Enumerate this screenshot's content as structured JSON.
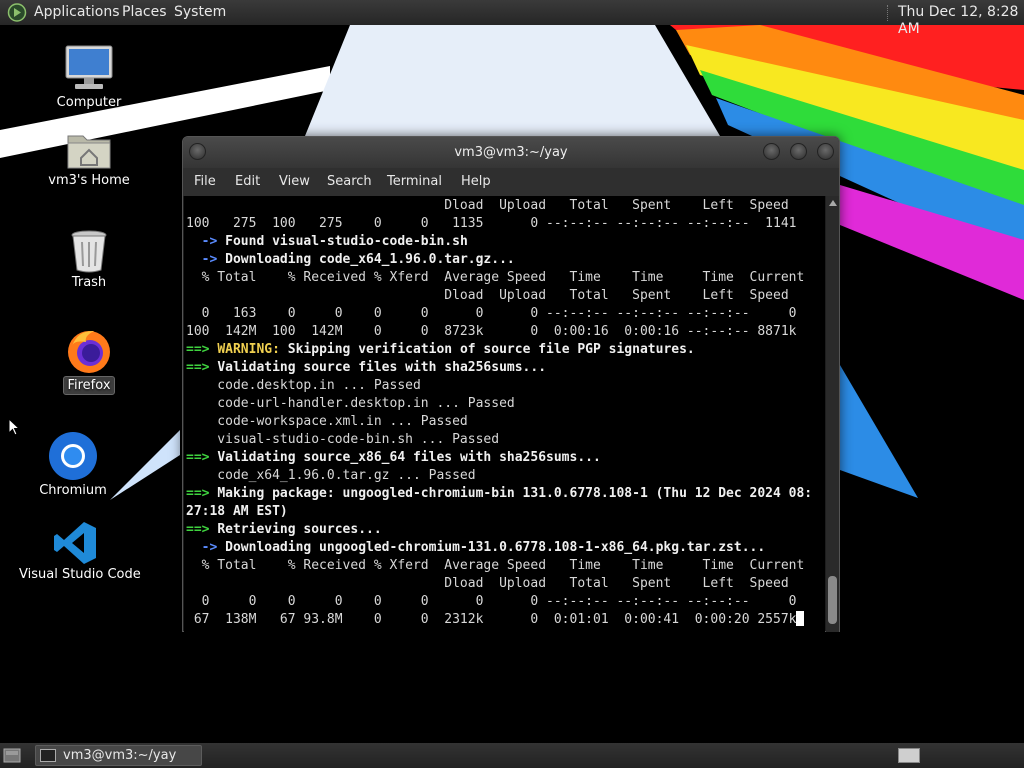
{
  "top_panel": {
    "menus": [
      "Applications",
      "Places",
      "System"
    ],
    "clock": "Thu Dec 12,  8:28 AM"
  },
  "desktop_icons": [
    {
      "label": "Computer",
      "icon": "computer-icon"
    },
    {
      "label": "vm3's Home",
      "icon": "home-folder-icon"
    },
    {
      "label": "Trash",
      "icon": "trash-icon"
    },
    {
      "label": "Firefox",
      "icon": "firefox-icon"
    },
    {
      "label": "Chromium",
      "icon": "chromium-icon"
    },
    {
      "label": "Visual Studio Code",
      "icon": "vscode-icon"
    }
  ],
  "terminal": {
    "title": "vm3@vm3:~/yay",
    "menu": [
      "File",
      "Edit",
      "View",
      "Search",
      "Terminal",
      "Help"
    ],
    "lines": [
      "                                 Dload  Upload   Total   Spent    Left  Speed",
      "100   275  100   275    0     0   1135      0 --:--:-- --:--:-- --:--:--  1141",
      "  -> Found visual-studio-code-bin.sh",
      "  -> Downloading code_x64_1.96.0.tar.gz...",
      "  % Total    % Received % Xferd  Average Speed   Time    Time     Time  Current",
      "                                 Dload  Upload   Total   Spent    Left  Speed",
      "  0   163    0     0    0     0      0      0 --:--:-- --:--:-- --:--:--     0",
      "100  142M  100  142M    0     0  8723k      0  0:00:16  0:00:16 --:--:-- 8871k",
      "==> WARNING: Skipping verification of source file PGP signatures.",
      "==> Validating source files with sha256sums...",
      "    code.desktop.in ... Passed",
      "    code-url-handler.desktop.in ... Passed",
      "    code-workspace.xml.in ... Passed",
      "    visual-studio-code-bin.sh ... Passed",
      "==> Validating source_x86_64 files with sha256sums...",
      "    code_x64_1.96.0.tar.gz ... Passed",
      "==> Making package: ungoogled-chromium-bin 131.0.6778.108-1 (Thu 12 Dec 2024 08:",
      "27:18 AM EST)",
      "==> Retrieving sources...",
      "  -> Downloading ungoogled-chromium-131.0.6778.108-1-x86_64.pkg.tar.zst...",
      "  % Total    % Received % Xferd  Average Speed   Time    Time     Time  Current",
      "                                 Dload  Upload   Total   Spent    Left  Speed",
      "  0     0    0     0    0     0      0      0 --:--:-- --:--:-- --:--:--     0",
      " 67  138M   67 93.8M    0     0  2312k      0  0:01:01  0:00:41  0:00:20 2557k"
    ]
  },
  "taskbar": {
    "task_label": "vm3@vm3:~/yay"
  },
  "colors": {
    "arrow_green": "#3fd43f",
    "arrow_blue": "#5b8cff",
    "warning_yellow": "#f0d050",
    "panel_bg": "#2e2e2e"
  }
}
